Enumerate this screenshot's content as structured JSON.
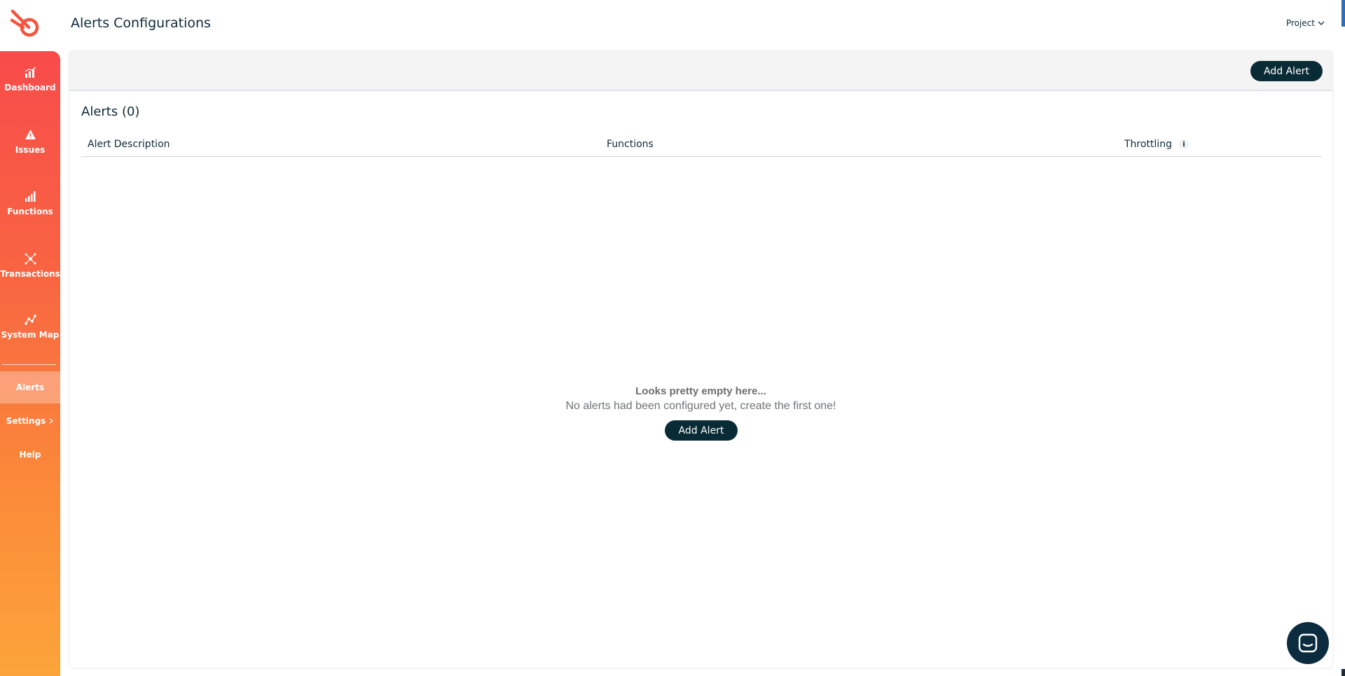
{
  "app": {
    "title": "Alerts Configurations",
    "project_label": "Project"
  },
  "sidebar": {
    "items": [
      {
        "label": "Dashboard",
        "icon": "dashboard-chart-icon"
      },
      {
        "label": "Issues",
        "icon": "warning-triangle-icon"
      },
      {
        "label": "Functions",
        "icon": "bar-chart-icon"
      },
      {
        "label": "Transactions",
        "icon": "network-icon"
      },
      {
        "label": "System Map",
        "icon": "map-graph-icon"
      }
    ],
    "text_items": [
      {
        "label": "Alerts",
        "active": true
      },
      {
        "label": "Settings",
        "has_chevron": true
      },
      {
        "label": "Help"
      }
    ]
  },
  "toolbar": {
    "add_label": "Add Alert"
  },
  "alerts": {
    "heading": "Alerts (0)",
    "columns": [
      "Alert Description",
      "Functions",
      "Throttling"
    ],
    "throttling_info": "i"
  },
  "empty_state": {
    "title": "Looks pretty empty here...",
    "subtitle": "No alerts had been configured yet, create the first one!",
    "button_label": "Add Alert"
  },
  "colors": {
    "sidebar_top": "#f84b4b",
    "sidebar_bottom": "#fca43a",
    "button_bg": "#092b36",
    "chat_bg": "#0b2b3e"
  }
}
